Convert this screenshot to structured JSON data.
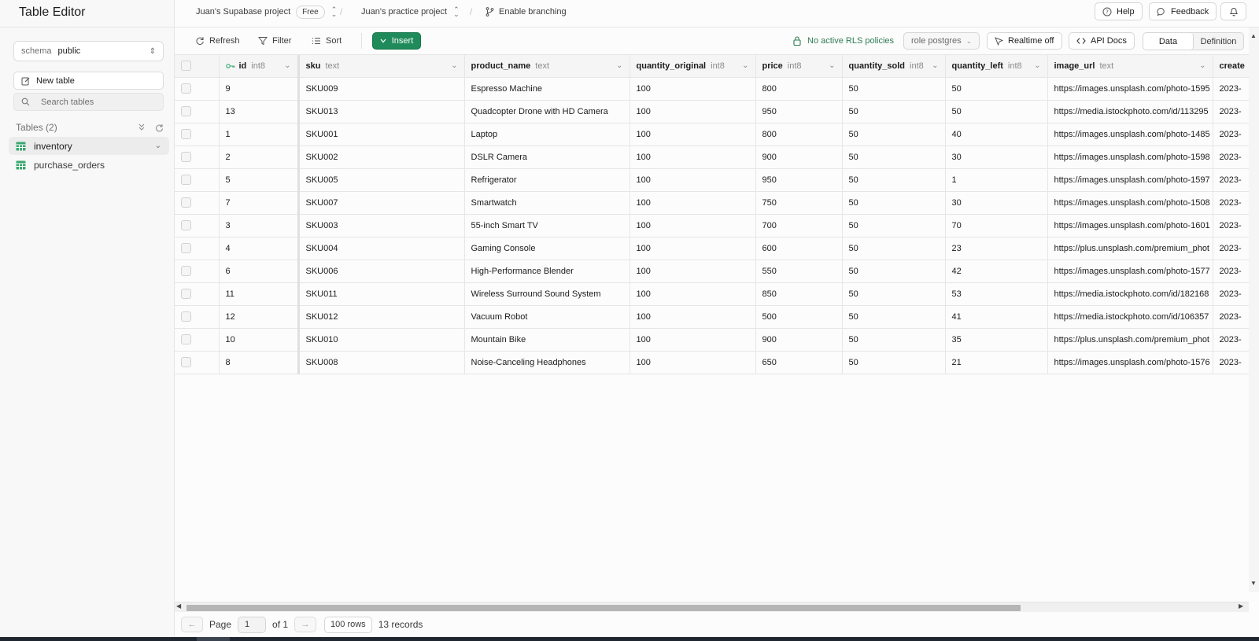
{
  "sidebar": {
    "title": "Table Editor",
    "schema_label": "schema",
    "schema_value": "public",
    "new_table": "New table",
    "search_placeholder": "Search tables",
    "tables_heading": "Tables (2)",
    "tables": [
      {
        "name": "inventory",
        "active": true
      },
      {
        "name": "purchase_orders",
        "active": false
      }
    ]
  },
  "topbar": {
    "org": "Juan's Supabase project",
    "plan_badge": "Free",
    "project": "Juan's practice project",
    "branching": "Enable branching",
    "help": "Help",
    "feedback": "Feedback"
  },
  "toolbar": {
    "refresh": "Refresh",
    "filter": "Filter",
    "sort": "Sort",
    "insert": "Insert",
    "rls": "No active RLS policies",
    "role": "role postgres",
    "realtime": "Realtime off",
    "api_docs": "API Docs",
    "tab_data": "Data",
    "tab_definition": "Definition"
  },
  "columns": [
    {
      "name": "id",
      "type": "int8",
      "primary_key": true
    },
    {
      "name": "sku",
      "type": "text"
    },
    {
      "name": "product_name",
      "type": "text"
    },
    {
      "name": "quantity_original",
      "type": "int8"
    },
    {
      "name": "price",
      "type": "int8"
    },
    {
      "name": "quantity_sold",
      "type": "int8"
    },
    {
      "name": "quantity_left",
      "type": "int8"
    },
    {
      "name": "image_url",
      "type": "text"
    },
    {
      "name": "create",
      "type": ""
    }
  ],
  "rows": [
    [
      "9",
      "SKU009",
      "Espresso Machine",
      "100",
      "800",
      "50",
      "50",
      "https://images.unsplash.com/photo-1595",
      "2023-"
    ],
    [
      "13",
      "SKU013",
      "Quadcopter Drone with HD Camera",
      "100",
      "950",
      "50",
      "50",
      "https://media.istockphoto.com/id/113295",
      "2023-"
    ],
    [
      "1",
      "SKU001",
      "Laptop",
      "100",
      "800",
      "50",
      "40",
      "https://images.unsplash.com/photo-1485",
      "2023-"
    ],
    [
      "2",
      "SKU002",
      "DSLR Camera",
      "100",
      "900",
      "50",
      "30",
      "https://images.unsplash.com/photo-1598",
      "2023-"
    ],
    [
      "5",
      "SKU005",
      "Refrigerator",
      "100",
      "950",
      "50",
      "1",
      "https://images.unsplash.com/photo-1597",
      "2023-"
    ],
    [
      "7",
      "SKU007",
      "Smartwatch",
      "100",
      "750",
      "50",
      "30",
      "https://images.unsplash.com/photo-1508",
      "2023-"
    ],
    [
      "3",
      "SKU003",
      "55-inch Smart TV",
      "100",
      "700",
      "50",
      "70",
      "https://images.unsplash.com/photo-1601",
      "2023-"
    ],
    [
      "4",
      "SKU004",
      "Gaming Console",
      "100",
      "600",
      "50",
      "23",
      "https://plus.unsplash.com/premium_phot",
      "2023-"
    ],
    [
      "6",
      "SKU006",
      "High-Performance Blender",
      "100",
      "550",
      "50",
      "42",
      "https://images.unsplash.com/photo-1577",
      "2023-"
    ],
    [
      "11",
      "SKU011",
      "Wireless Surround Sound System",
      "100",
      "850",
      "50",
      "53",
      "https://media.istockphoto.com/id/182168",
      "2023-"
    ],
    [
      "12",
      "SKU012",
      "Vacuum Robot",
      "100",
      "500",
      "50",
      "41",
      "https://media.istockphoto.com/id/106357",
      "2023-"
    ],
    [
      "10",
      "SKU010",
      "Mountain Bike",
      "100",
      "900",
      "50",
      "35",
      "https://plus.unsplash.com/premium_phot",
      "2023-"
    ],
    [
      "8",
      "SKU008",
      "Noise-Canceling Headphones",
      "100",
      "650",
      "50",
      "21",
      "https://images.unsplash.com/photo-1576",
      "2023-"
    ]
  ],
  "footer": {
    "page_label": "Page",
    "page_value": "1",
    "of_label": "of 1",
    "rows_per_page": "100 rows",
    "records": "13 records"
  },
  "colors": {
    "accent": "#1f8b5a",
    "rls_text": "#2e7d55",
    "table_icon": "#3aa870"
  }
}
